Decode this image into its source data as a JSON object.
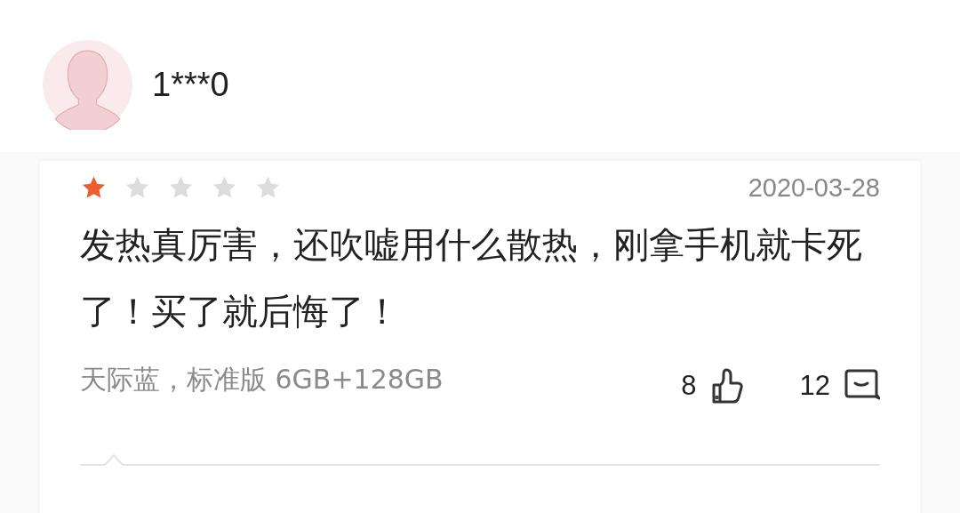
{
  "user": {
    "name": "1***0"
  },
  "review": {
    "stars": 1,
    "date": "2020-03-28",
    "text": "发热真厉害，还吹嘘用什么散热，刚拿手机就卡死了！买了就后悔了！",
    "variant": "天际蓝，标准版 6GB+128GB",
    "likes": "8",
    "comments": "12"
  }
}
